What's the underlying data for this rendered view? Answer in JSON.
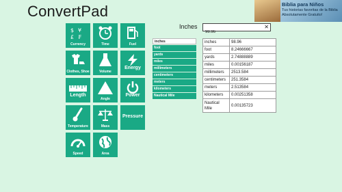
{
  "app": {
    "title": "ConvertPad"
  },
  "ad": {
    "title": "Biblia para Niños",
    "line1": "Tus historias favoritas de la Biblia",
    "line2": "Absolutamente Gratuito!"
  },
  "categories": [
    {
      "label": "Currency",
      "icon": "currency-icon"
    },
    {
      "label": "Time",
      "icon": "alarm-clock-icon"
    },
    {
      "label": "Fuel",
      "icon": "fuel-pump-icon"
    },
    {
      "label": "Clothes, Shoe",
      "icon": "clothes-icon"
    },
    {
      "label": "Volume",
      "icon": "flask-icon"
    },
    {
      "label": "Energy",
      "icon": "lightning-icon"
    },
    {
      "label": "Length",
      "icon": "ruler-icon"
    },
    {
      "label": "Angle",
      "icon": "triangle-icon"
    },
    {
      "label": "Power",
      "icon": "power-icon"
    },
    {
      "label": "Temperature",
      "icon": "thermometer-icon"
    },
    {
      "label": "Mass",
      "icon": "scale-icon"
    },
    {
      "label": "Pressure",
      "icon": ""
    },
    {
      "label": "Speed",
      "icon": "speedometer-icon"
    },
    {
      "label": "Area",
      "icon": "globe-icon"
    }
  ],
  "input": {
    "label": "Inches",
    "value": "98.96",
    "clear": "✕"
  },
  "units": [
    "inches",
    "foot",
    "yards",
    "miles",
    "millimeters",
    "centimeters",
    "meters",
    "kilometers",
    "Nautical Mile"
  ],
  "results": [
    {
      "unit": "inches",
      "value": "98.96"
    },
    {
      "unit": "foot",
      "value": "8.24666667"
    },
    {
      "unit": "yards",
      "value": "2.74888889"
    },
    {
      "unit": "miles",
      "value": "0.00156187"
    },
    {
      "unit": "millimeters",
      "value": "2513.584"
    },
    {
      "unit": "centimeters",
      "value": "251.3584"
    },
    {
      "unit": "meters",
      "value": "2.513584"
    },
    {
      "unit": "kilometers",
      "value": "0.00251358"
    },
    {
      "unit": "Nautical Mile",
      "value": "0.00135723"
    }
  ],
  "colors": {
    "background": "#d9f5e3",
    "tile": "#1aa985"
  }
}
